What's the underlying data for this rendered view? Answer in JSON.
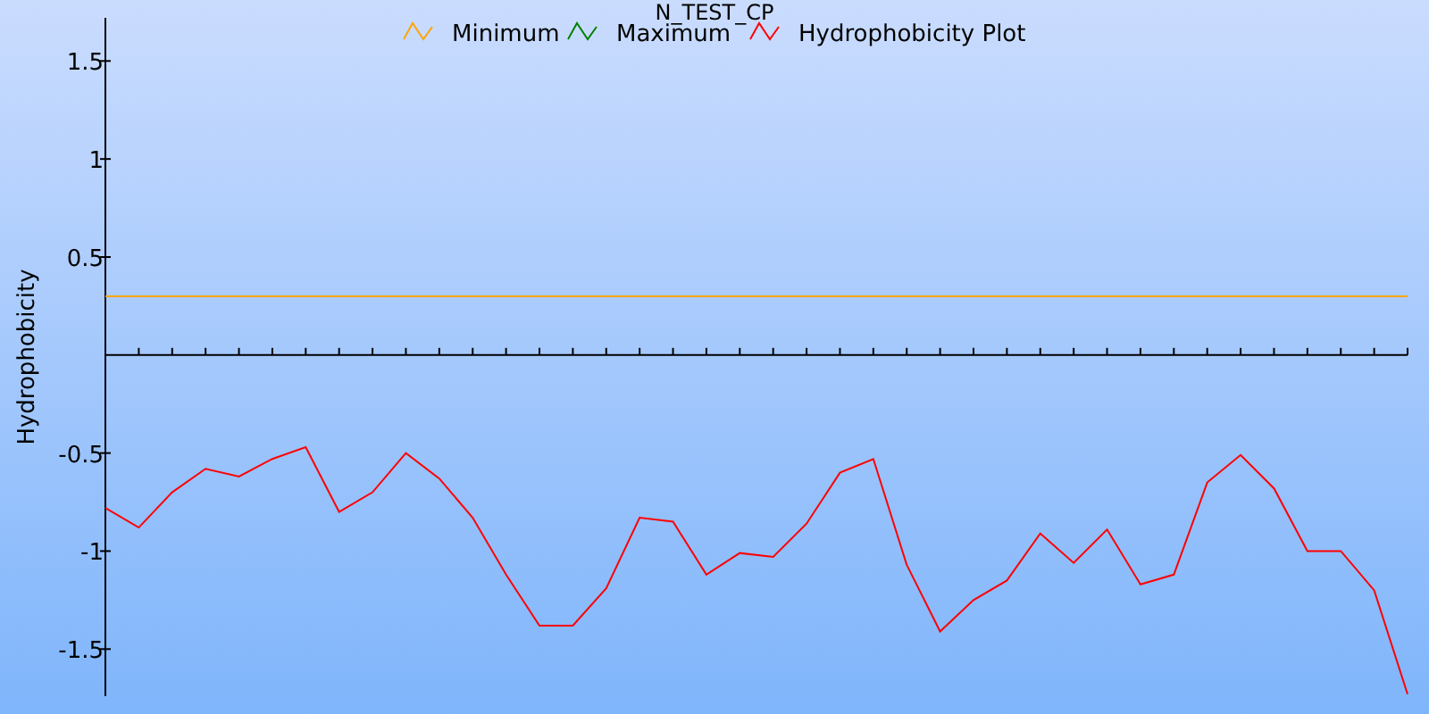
{
  "chart": {
    "chart_data": {
      "type": "line",
      "title": "N_TEST_CP",
      "ylabel": "Hydrophobicity",
      "legend": "top",
      "ylim": [
        -1.74,
        1.72
      ],
      "yticks": [
        -1.5,
        -1,
        -0.5,
        0.5,
        1,
        1.5
      ],
      "series": [
        {
          "name": "Minimum",
          "color": "#ffa500",
          "values": [
            0.3,
            0.3,
            0.3,
            0.3,
            0.3,
            0.3,
            0.3,
            0.3,
            0.3,
            0.3,
            0.3,
            0.3,
            0.3,
            0.3,
            0.3,
            0.3,
            0.3,
            0.3,
            0.3,
            0.3,
            0.3,
            0.3,
            0.3,
            0.3,
            0.3,
            0.3,
            0.3,
            0.3,
            0.3,
            0.3,
            0.3,
            0.3,
            0.3,
            0.3,
            0.3,
            0.3,
            0.3,
            0.3,
            0.3,
            0.3
          ]
        },
        {
          "name": "Maximum",
          "color": "#008000",
          "values": [
            null,
            null,
            null,
            null,
            null,
            null,
            null,
            null,
            null,
            null,
            null,
            null,
            null,
            null,
            null,
            null,
            null,
            null,
            null,
            null,
            null,
            null,
            null,
            null,
            null,
            null,
            null,
            null,
            null,
            null,
            null,
            null,
            null,
            null,
            null,
            null,
            null,
            null,
            null,
            null
          ]
        },
        {
          "name": "Hydrophobicity Plot",
          "color": "#ff0000",
          "values": [
            -0.78,
            -0.88,
            -0.7,
            -0.58,
            -0.62,
            -0.53,
            -0.47,
            -0.8,
            -0.7,
            -0.5,
            -0.63,
            -0.83,
            -1.12,
            -1.38,
            -1.38,
            -1.19,
            -0.83,
            -0.85,
            -1.12,
            -1.01,
            -1.03,
            -0.86,
            -0.6,
            -0.53,
            -1.07,
            -1.41,
            -1.25,
            -1.15,
            -0.91,
            -1.06,
            -0.89,
            -1.17,
            -1.12,
            -0.65,
            -0.51,
            -0.68,
            -1.0,
            -1.0,
            -1.2,
            -1.73
          ]
        }
      ]
    }
  }
}
